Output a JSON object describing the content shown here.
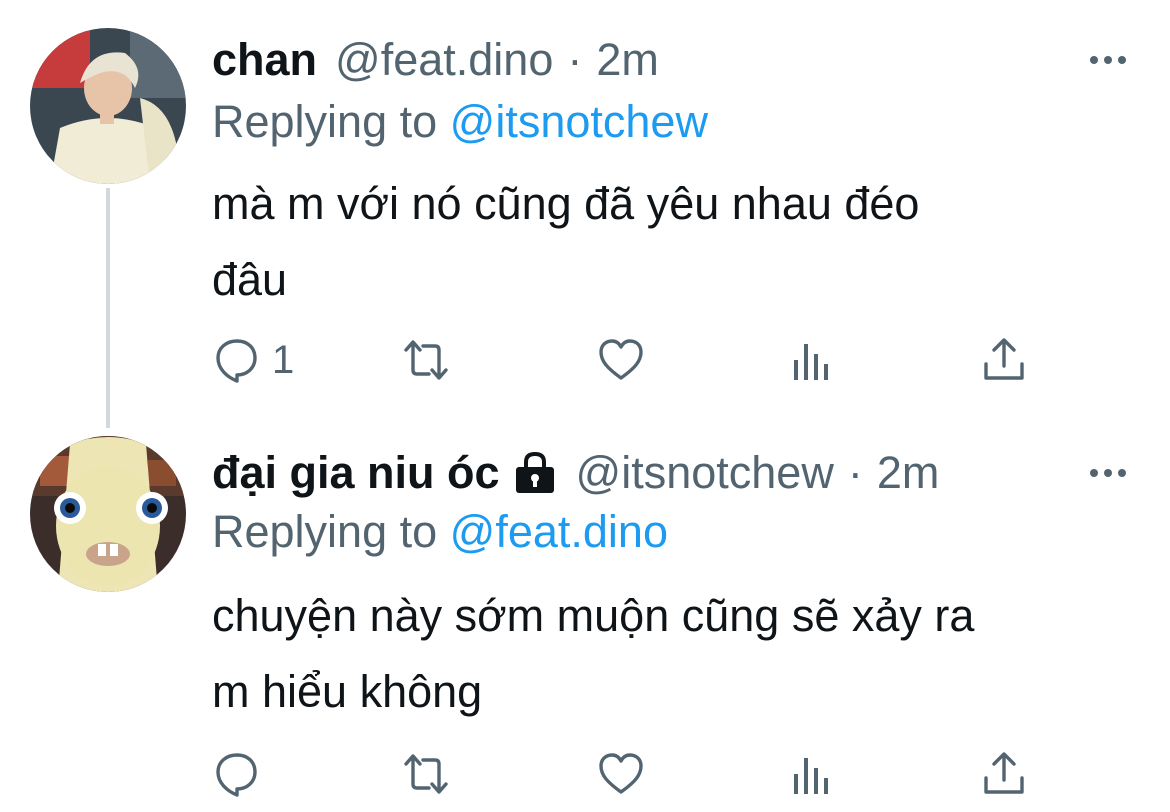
{
  "tweets": [
    {
      "display_name": "chan",
      "handle": "@feat.dino",
      "separator": "·",
      "time": "2m",
      "replying_label": "Replying to",
      "replying_to": "@itsnotchew",
      "text_line1": "mà m với nó cũng đã yêu nhau đéo",
      "text_line2": "đâu",
      "reply_count": "1",
      "avatar_icon": "avatar-blonde-person",
      "locked": false
    },
    {
      "display_name": "đại gia niu óc",
      "handle": "@itsnotchew",
      "separator": "·",
      "time": "2m",
      "replying_label": "Replying to",
      "replying_to": "@feat.dino",
      "text_line1": "chuyện này sớm muộn cũng sẽ xảy ra",
      "text_line2": "m hiểu không",
      "reply_count": "",
      "avatar_icon": "avatar-rabbid-creature",
      "locked": true
    }
  ],
  "icons": {
    "reply": "reply-icon",
    "retweet": "retweet-icon",
    "like": "heart-icon",
    "stats": "stats-icon",
    "share": "share-icon",
    "more": "more-icon",
    "lock": "lock-icon"
  },
  "colors": {
    "text": "#0f1419",
    "secondary": "#536471",
    "link": "#1d9bf0",
    "thread_line": "#cfd9de"
  }
}
